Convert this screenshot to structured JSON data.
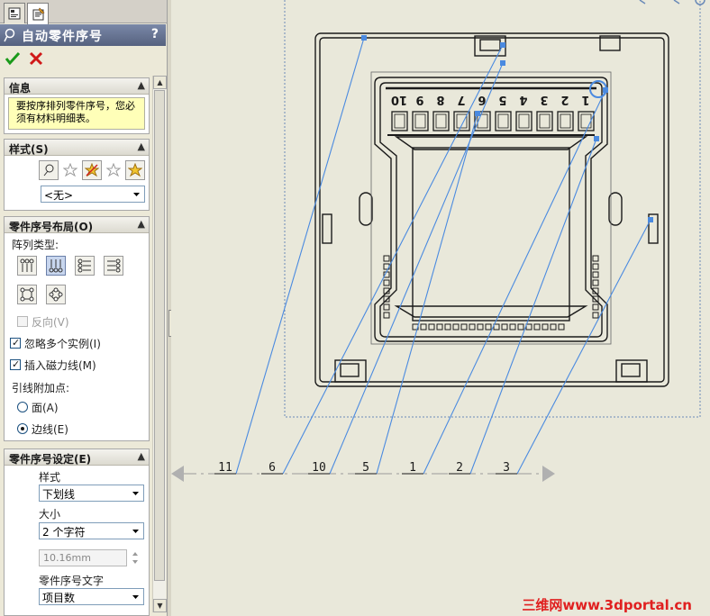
{
  "feature": {
    "title": "自动零件序号",
    "help": "?"
  },
  "info": {
    "header": "信息",
    "message": "要按序排列零件序号，您必须有材料明细表。"
  },
  "style_group": {
    "header": "样式(S)",
    "style_value": "<无>"
  },
  "layout_group": {
    "header": "零件序号布局(O)",
    "pattern_label": "阵列类型:",
    "reverse_label": "反向(V)",
    "ignore_instances_label": "忽略多个实例(I)",
    "insert_magnetic_label": "插入磁力线(M)",
    "leader_attach_label": "引线附加点:",
    "face_label": "面(A)",
    "edge_label": "边线(E)",
    "ignore_instances_checked": true,
    "insert_magnetic_checked": true,
    "reverse_checked": false,
    "selected_attach": "edge"
  },
  "settings_group": {
    "header": "零件序号设定(E)",
    "style_label": "样式",
    "style_value": "下划线",
    "size_label": "大小",
    "size_value": "2 个字符",
    "size_mm": "10.16mm",
    "text_label": "零件序号文字",
    "text_value": "项目数"
  },
  "drawing": {
    "balloon_numbers": [
      "11",
      "6",
      "10",
      "5",
      "1",
      "2",
      "3"
    ],
    "slot_digits": [
      "10",
      "9",
      "8",
      "7",
      "6",
      "5",
      "4",
      "3",
      "2",
      "1"
    ],
    "colors": {
      "line": "#1a1a1a",
      "leader": "#4a8ae0",
      "frame": "#6a8ab8",
      "hatch": "#9a9a9a"
    }
  },
  "watermark": "三维网www.3dportal.cn"
}
